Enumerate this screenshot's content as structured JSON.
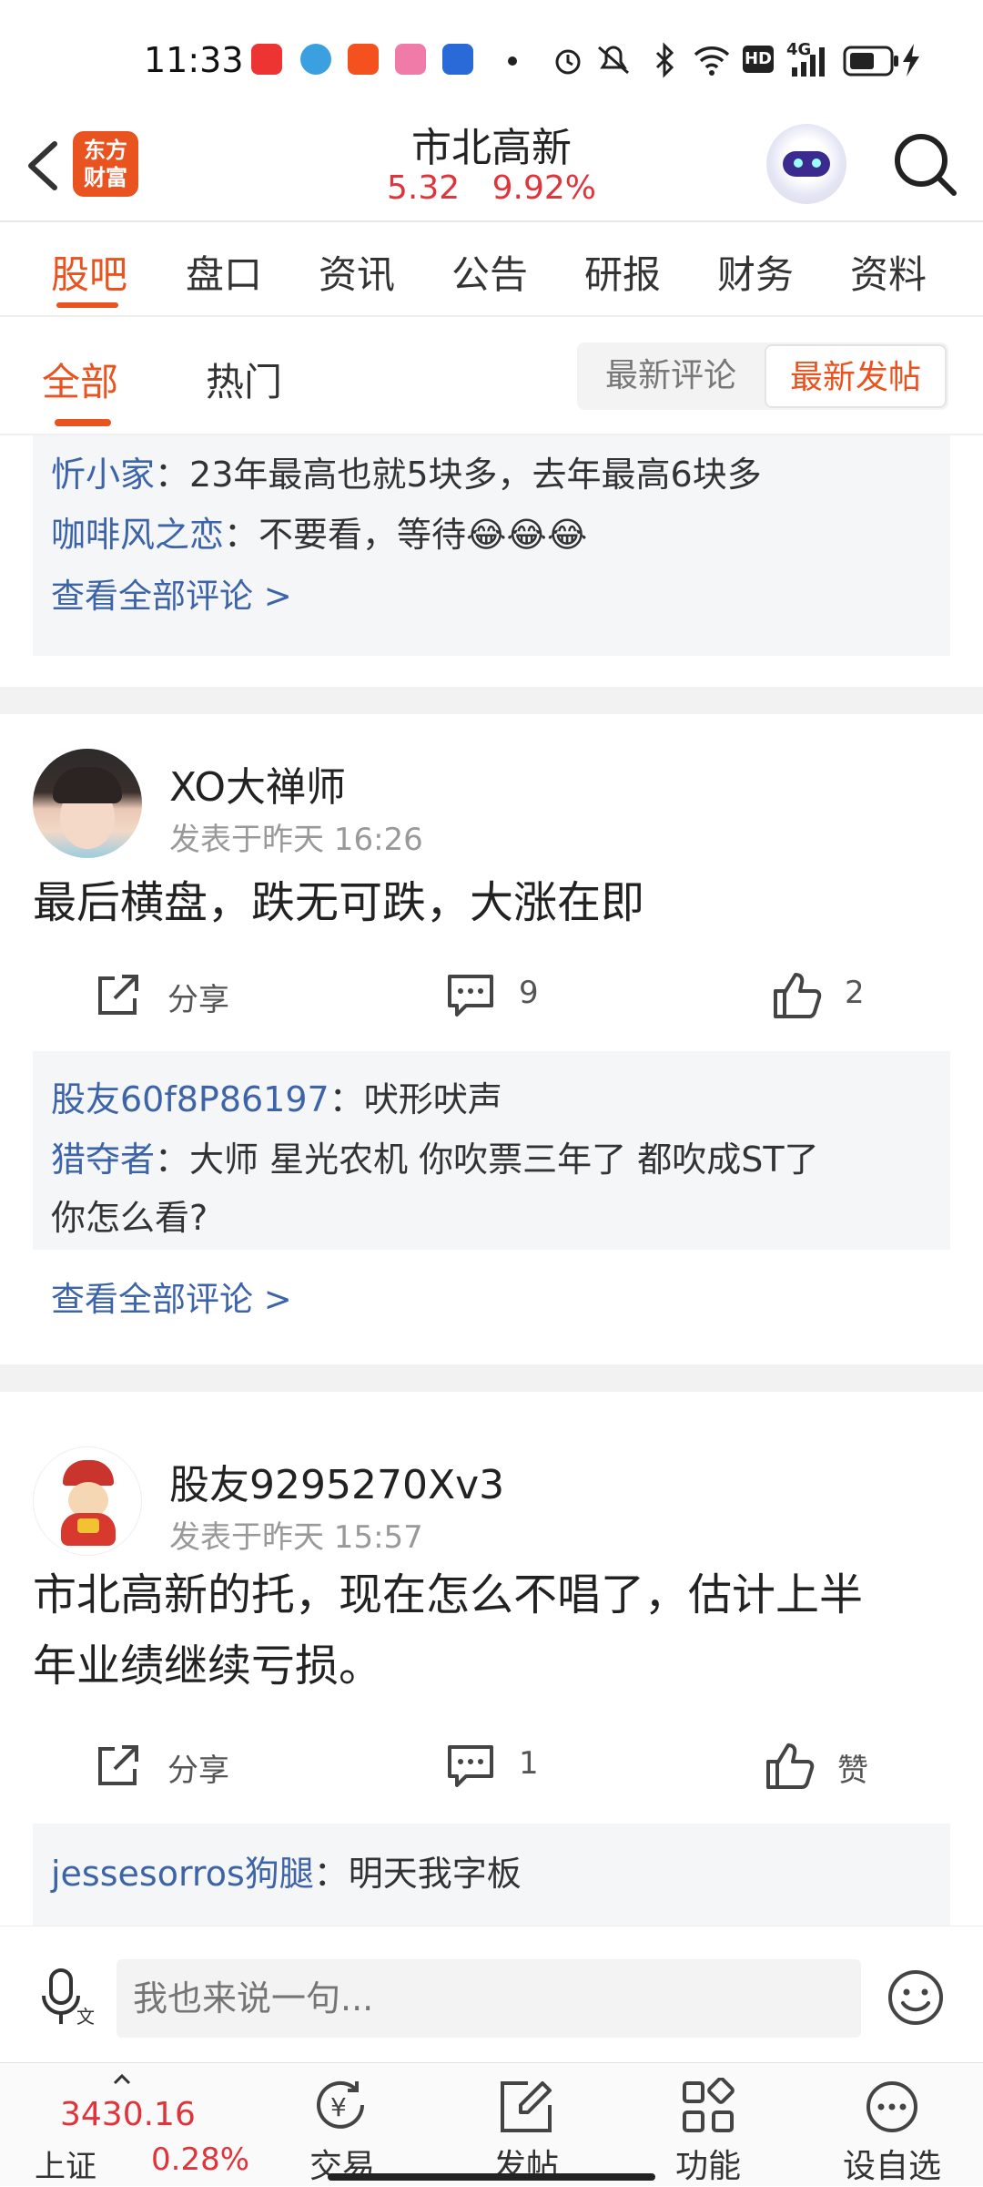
{
  "status_bar": {
    "time": "11:33",
    "network": "4G",
    "hd": "HD"
  },
  "header": {
    "logo_line1": "东方",
    "logo_line2": "财富",
    "stock_name": "市北高新",
    "price": "5.32",
    "change_pct": "9.92%"
  },
  "main_tabs": [
    "股吧",
    "盘口",
    "资讯",
    "公告",
    "研报",
    "财务",
    "资料"
  ],
  "sub_tabs": {
    "all": "全部",
    "hot": "热门",
    "sort_latest_comment": "最新评论",
    "sort_latest_post": "最新发帖"
  },
  "feed": {
    "partial_comments": [
      {
        "user": "忻小家",
        "text": "：23年最高也就5块多，去年最高6块多"
      },
      {
        "user": "咖啡风之恋",
        "text": "：不要看，等待😂😂😂"
      }
    ],
    "partial_more": "查看全部评论 >",
    "posts": [
      {
        "user": "XO大禅师",
        "time": "发表于昨天 16:26",
        "text": "最后横盘，跌无可跌，大涨在即",
        "share_label": "分享",
        "comment_count": "9",
        "like_count": "2",
        "comments": [
          {
            "user": "股友60f8P86197",
            "text": "：吠形吠声"
          },
          {
            "user": "猎夺者",
            "text": "：大师 星光农机 你吹票三年了 都吹成ST了",
            "text_cont": "你怎么看?"
          }
        ],
        "more": "查看全部评论 >"
      },
      {
        "user": "股友9295270Xv3",
        "time": "发表于昨天 15:57",
        "text_line1": "市北高新的托，现在怎么不唱了，估计上半",
        "text_line2": "年业绩继续亏损。",
        "share_label": "分享",
        "comment_count": "1",
        "like_label": "赞",
        "comments": [
          {
            "user": "jessesorros狗腿",
            "text": "：明天我字板"
          }
        ]
      }
    ]
  },
  "input_bar": {
    "placeholder": "我也来说一句..."
  },
  "bottom_nav": {
    "index_value": "3430.16",
    "index_name": "上证",
    "index_change": "0.28%",
    "items": [
      "交易",
      "发帖",
      "功能",
      "设自选"
    ]
  },
  "colors": {
    "accent": "#e8531f",
    "up": "#e0333a",
    "link": "#3d64a8"
  }
}
